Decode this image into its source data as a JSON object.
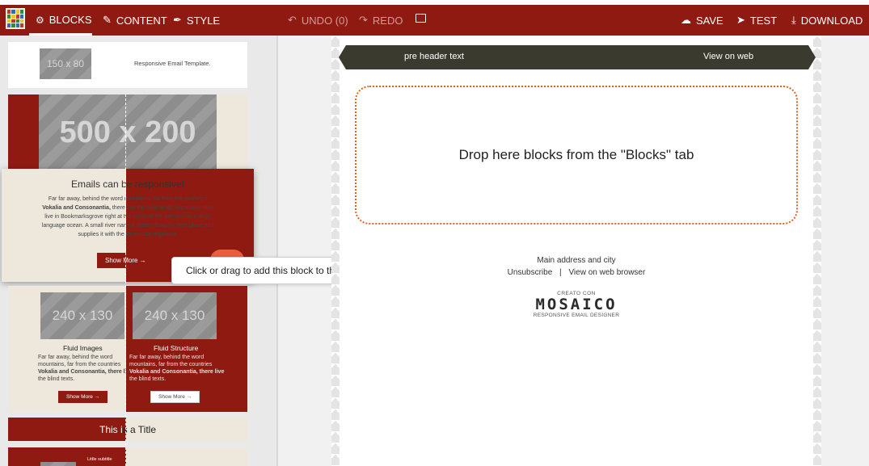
{
  "toolbar": {
    "blocks": "BLOCKS",
    "content": "CONTENT",
    "style": "STYLE",
    "undo": "UNDO (0)",
    "redo": "REDO",
    "save": "SAVE",
    "test": "TEST",
    "download": "DOWNLOAD"
  },
  "blocks_panel": {
    "logo_block": {
      "placeholder": "150 x 80",
      "text": "Responsive Email Template."
    },
    "hero_block": {
      "placeholder": "500 x 200"
    },
    "responsive_block": {
      "title": "Emails can be responsive!",
      "body_1": "Far far away, behind the word mountains, far from the countries",
      "body_2_bold": "Vokalia and Consonantia,",
      "body_2": " there live the blind texts. Separated they",
      "body_3": "live in Bookmarksgrove right at the coast of the Semantics, a large",
      "body_4": "language ocean. A small river named Duden flows by their place and",
      "body_5": "supplies it with the necessary regelialia.",
      "button": "Show More →"
    },
    "two_col_block": {
      "left": {
        "placeholder": "240 x 130",
        "title": "Fluid Images",
        "text_1": "Far far away, behind the word",
        "text_2": "mountains, far from the countries",
        "text_3": "Vokalia and Consonantia, there live",
        "text_4": "the blind texts.",
        "button": "Show More →"
      },
      "right": {
        "placeholder": "240 x 130",
        "title": "Fluid Structure",
        "text_1": "Far far away, behind the word",
        "text_2": "mountains, far from the countries",
        "text_3": "Vokalia and Consonantia, there live",
        "text_4": "the blind texts.",
        "button": "Show More →"
      }
    },
    "title_block": {
      "text": "This is a Title"
    },
    "partial_block": {
      "text": "Little subtitle"
    }
  },
  "tooltip": "Click or drag to add this block to the template",
  "canvas": {
    "preheader_text": "pre header text",
    "view_on_web": "View on web",
    "drop_message": "Drop here blocks from the \"Blocks\" tab",
    "address": "Main address and city",
    "unsubscribe": "Unsubscribe",
    "separator": "|",
    "view_browser": "View on web browser",
    "credit_top": "CREATO CON",
    "credit_brand": "MOSAICO",
    "credit_bottom": "RESPONSIVE EMAIL DESIGNER"
  },
  "colors": {
    "brand": "#8f1a12",
    "cream": "#ede7dc",
    "dark": "#3a3a2f",
    "drop_border": "#e1621f"
  },
  "icons": {
    "blocks": "blocks-icon",
    "content": "pencil-icon",
    "style": "brush-icon",
    "undo": "undo-icon",
    "redo": "redo-icon",
    "image": "image-icon",
    "save": "cloud-upload-icon",
    "test": "send-icon",
    "download": "download-icon"
  }
}
